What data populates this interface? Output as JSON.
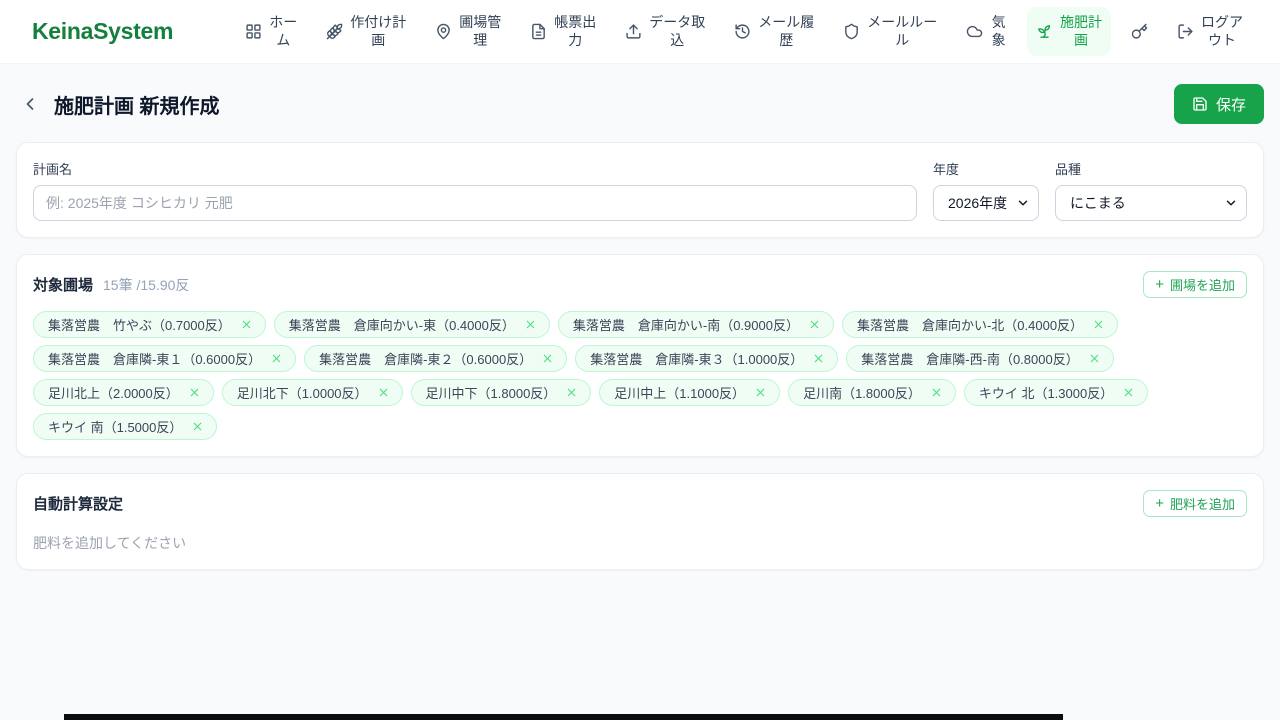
{
  "brand": {
    "name": "KeinaSystem"
  },
  "colors": {
    "primary": "#16a34a",
    "logo_green": "#15803d",
    "active_nav_bg": "#f0fdf4",
    "tag_bg": "#f0fdf4",
    "tag_border": "#bbf7d0"
  },
  "icons": {
    "plus": "+"
  },
  "nav": {
    "items": [
      {
        "label": "ホーム",
        "icon": "grid-icon"
      },
      {
        "label": "作付け計画",
        "icon": "wheat-icon"
      },
      {
        "label": "圃場管理",
        "icon": "map-pin-icon"
      },
      {
        "label": "帳票出力",
        "icon": "document-icon"
      },
      {
        "label": "データ取込",
        "icon": "upload-icon"
      },
      {
        "label": "メール履歴",
        "icon": "history-icon"
      },
      {
        "label": "メールルール",
        "icon": "shield-icon"
      },
      {
        "label": "気象",
        "icon": "cloud-icon"
      },
      {
        "label": "施肥計画",
        "icon": "sprout-icon",
        "active": true
      },
      {
        "label": "",
        "icon": "key-icon"
      },
      {
        "label": "ログアウト",
        "icon": "logout-icon"
      }
    ]
  },
  "page": {
    "title": "施肥計画 新規作成",
    "save_label": "保存"
  },
  "form": {
    "plan_name": {
      "label": "計画名",
      "value": "",
      "placeholder": "例: 2025年度 コシヒカリ 元肥"
    },
    "year": {
      "label": "年度",
      "value": "2026年度"
    },
    "variety": {
      "label": "品種",
      "value": "にこまる"
    }
  },
  "fields": {
    "title": "対象圃場",
    "count_text": "15筆 /15.90反",
    "add_button_label": "圃場を追加",
    "tags": [
      {
        "label": "集落営農　竹やぶ（0.7000反）"
      },
      {
        "label": "集落営農　倉庫向かい-東（0.4000反）"
      },
      {
        "label": "集落営農　倉庫向かい-南（0.9000反）"
      },
      {
        "label": "集落営農　倉庫向かい-北（0.4000反）"
      },
      {
        "label": "集落営農　倉庫隣-東１（0.6000反）"
      },
      {
        "label": "集落営農　倉庫隣-東２（0.6000反）"
      },
      {
        "label": "集落営農　倉庫隣-東３（1.0000反）"
      },
      {
        "label": "集落営農　倉庫隣-西-南（0.8000反）"
      },
      {
        "label": "足川北上（2.0000反）"
      },
      {
        "label": "足川北下（1.0000反）"
      },
      {
        "label": "足川中下（1.8000反）"
      },
      {
        "label": "足川中上（1.1000反）"
      },
      {
        "label": "足川南（1.8000反）"
      },
      {
        "label": "キウイ 北（1.3000反）"
      },
      {
        "label": "キウイ 南（1.5000反）"
      }
    ]
  },
  "auto_calc": {
    "title": "自動計算設定",
    "add_button_label": "肥料を追加",
    "empty_text": "肥料を追加してください"
  }
}
